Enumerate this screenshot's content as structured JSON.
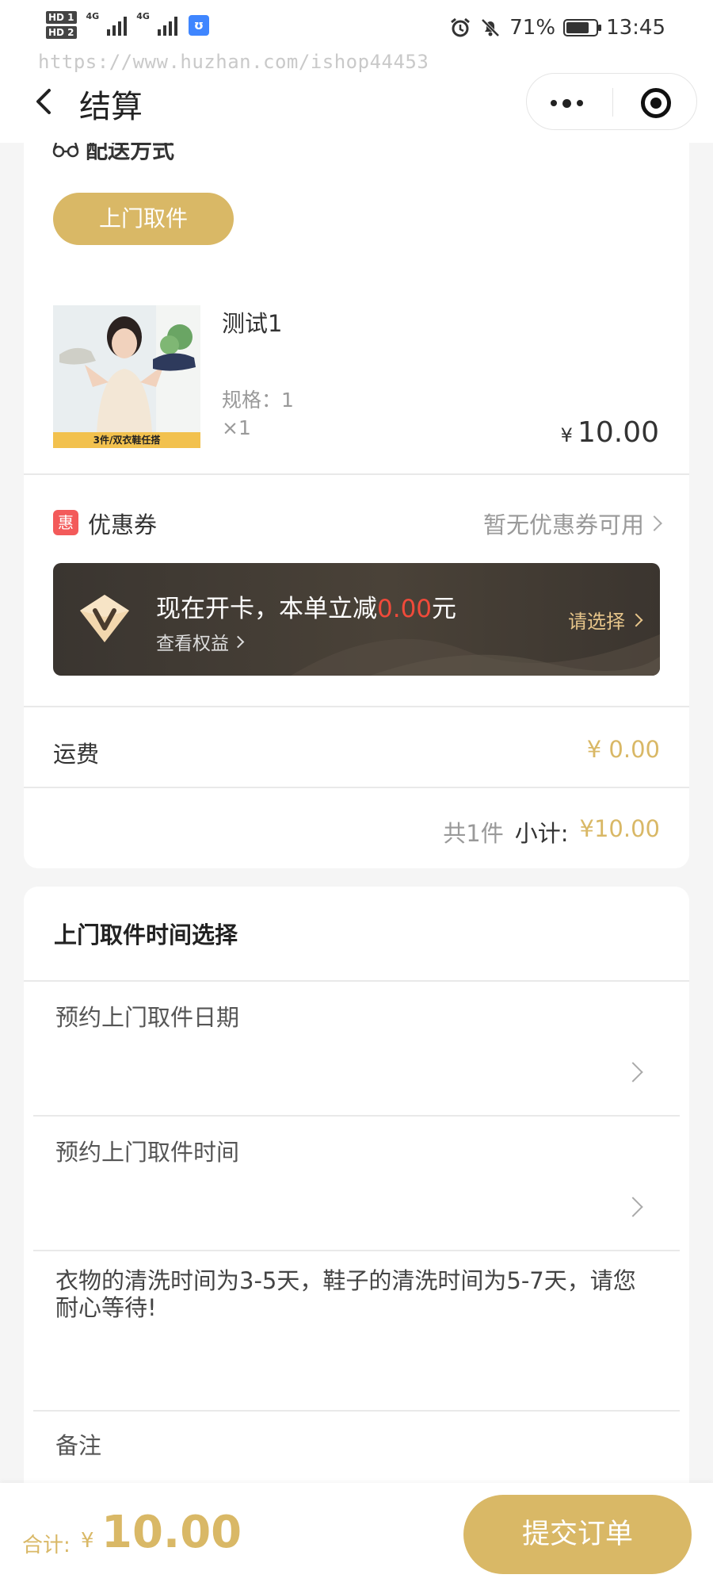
{
  "status_bar": {
    "hd1": "HD 1",
    "hd2": "HD 2",
    "net1": "4G",
    "net2": "4G",
    "app_badge": "ʊ",
    "battery": "71%",
    "time": "13:45"
  },
  "watermark": "https://www.huzhan.com/ishop44453",
  "nav": {
    "title": "结算"
  },
  "delivery": {
    "heading": "配送方式",
    "method_button": "上门取件"
  },
  "product": {
    "name": "测试1",
    "spec": "规格：1",
    "qty": "×1",
    "currency": "¥",
    "price": "10.00",
    "thumb_caption": "3件/双衣鞋任搭"
  },
  "coupon": {
    "icon_text": "惠",
    "label": "优惠券",
    "status": "暂无优惠券可用"
  },
  "vip_banner": {
    "title_prefix": "现在开卡，本单立减",
    "amount": "0.00",
    "title_suffix": "元",
    "sub": "查看权益",
    "action": "请选择"
  },
  "freight": {
    "label": "运费",
    "value": "¥ 0.00"
  },
  "subtotal": {
    "count": "共1件",
    "label": "小计:",
    "value": "¥10.00"
  },
  "pickup_time": {
    "title": "上门取件时间选择",
    "date_label": "预约上门取件日期",
    "time_label": "预约上门取件时间",
    "note": "衣物的清洗时间为3-5天，鞋子的清洗时间为5-7天，请您耐心等待!",
    "remark_label": "备注"
  },
  "footer": {
    "total_label": "合计:",
    "currency": "¥",
    "total": "10.00",
    "submit": "提交订单"
  },
  "colors": {
    "accent": "#d9b866",
    "discount": "#f04a3a",
    "coupon_icon": "#f35a5a"
  }
}
